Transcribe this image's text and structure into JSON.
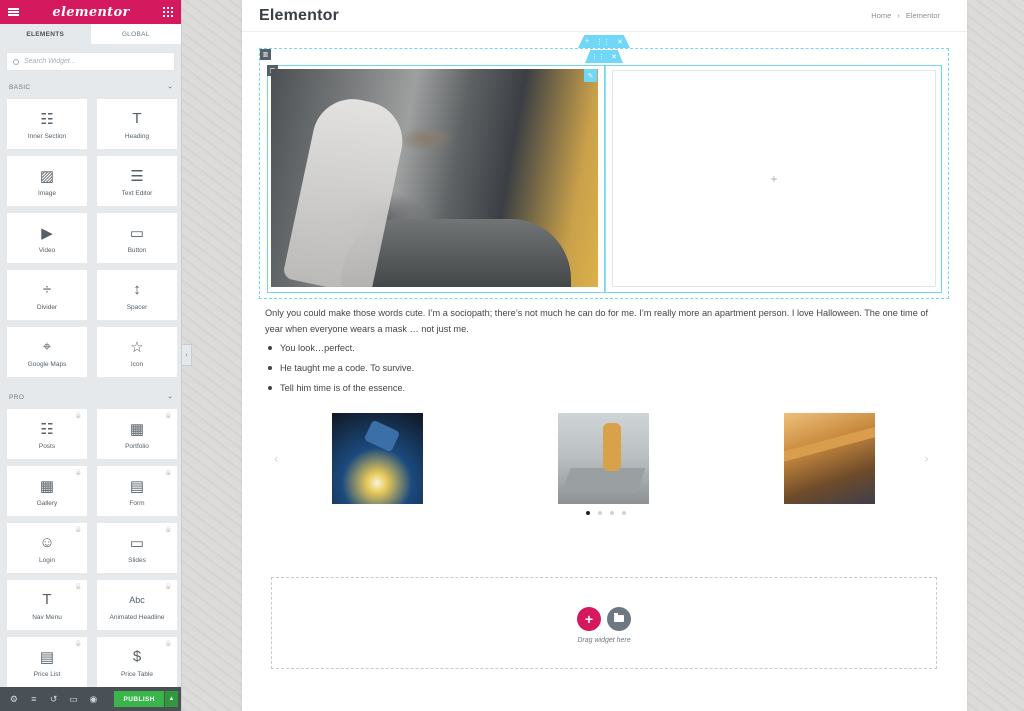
{
  "panel": {
    "brand": "elementor",
    "tabs": [
      "ELEMENTS",
      "GLOBAL"
    ],
    "search_placeholder": "Search Widget...",
    "basic_label": "BASIC",
    "basic_widgets": [
      {
        "label": "Inner Section",
        "icon": "inner-section-icon"
      },
      {
        "label": "Heading",
        "icon": "heading-icon"
      },
      {
        "label": "Image",
        "icon": "image-icon"
      },
      {
        "label": "Text Editor",
        "icon": "text-editor-icon"
      },
      {
        "label": "Video",
        "icon": "video-icon"
      },
      {
        "label": "Button",
        "icon": "button-icon"
      },
      {
        "label": "Divider",
        "icon": "divider-icon"
      },
      {
        "label": "Spacer",
        "icon": "spacer-icon"
      },
      {
        "label": "Google Maps",
        "icon": "map-icon"
      },
      {
        "label": "Icon",
        "icon": "star-icon"
      }
    ],
    "pro_label": "PRO",
    "pro_widgets": [
      {
        "label": "Posts",
        "icon": "posts-icon"
      },
      {
        "label": "Portfolio",
        "icon": "portfolio-icon"
      },
      {
        "label": "Gallery",
        "icon": "gallery-icon"
      },
      {
        "label": "Form",
        "icon": "form-icon"
      },
      {
        "label": "Login",
        "icon": "login-icon"
      },
      {
        "label": "Slides",
        "icon": "slides-icon"
      },
      {
        "label": "Nav Menu",
        "icon": "nav-menu-icon"
      },
      {
        "label": "Animated Headline",
        "icon": "animated-headline-icon"
      },
      {
        "label": "Price List",
        "icon": "price-list-icon"
      },
      {
        "label": "Price Table",
        "icon": "price-table-icon"
      }
    ],
    "publish_label": "PUBLISH"
  },
  "page": {
    "site_title": "Elementor",
    "breadcrumb": [
      "Home",
      "›",
      "Elementor"
    ],
    "paragraph": "Only you could make those words cute. I’m a sociopath; there’s not much he can do for me. I’m really more an apartment person. I love Halloween. The one time of year when everyone wears a mask … not just me.",
    "bullets": [
      "You look…perfect.",
      "He taught me a code. To survive.",
      "Tell him time is of the essence."
    ],
    "dropzone_hint": "Drag widget here",
    "carousel_active_index": 0,
    "carousel_dot_count": 4
  },
  "colors": {
    "brand": "#d5195e",
    "accent": "#71d7f7",
    "publish": "#39b54a"
  }
}
